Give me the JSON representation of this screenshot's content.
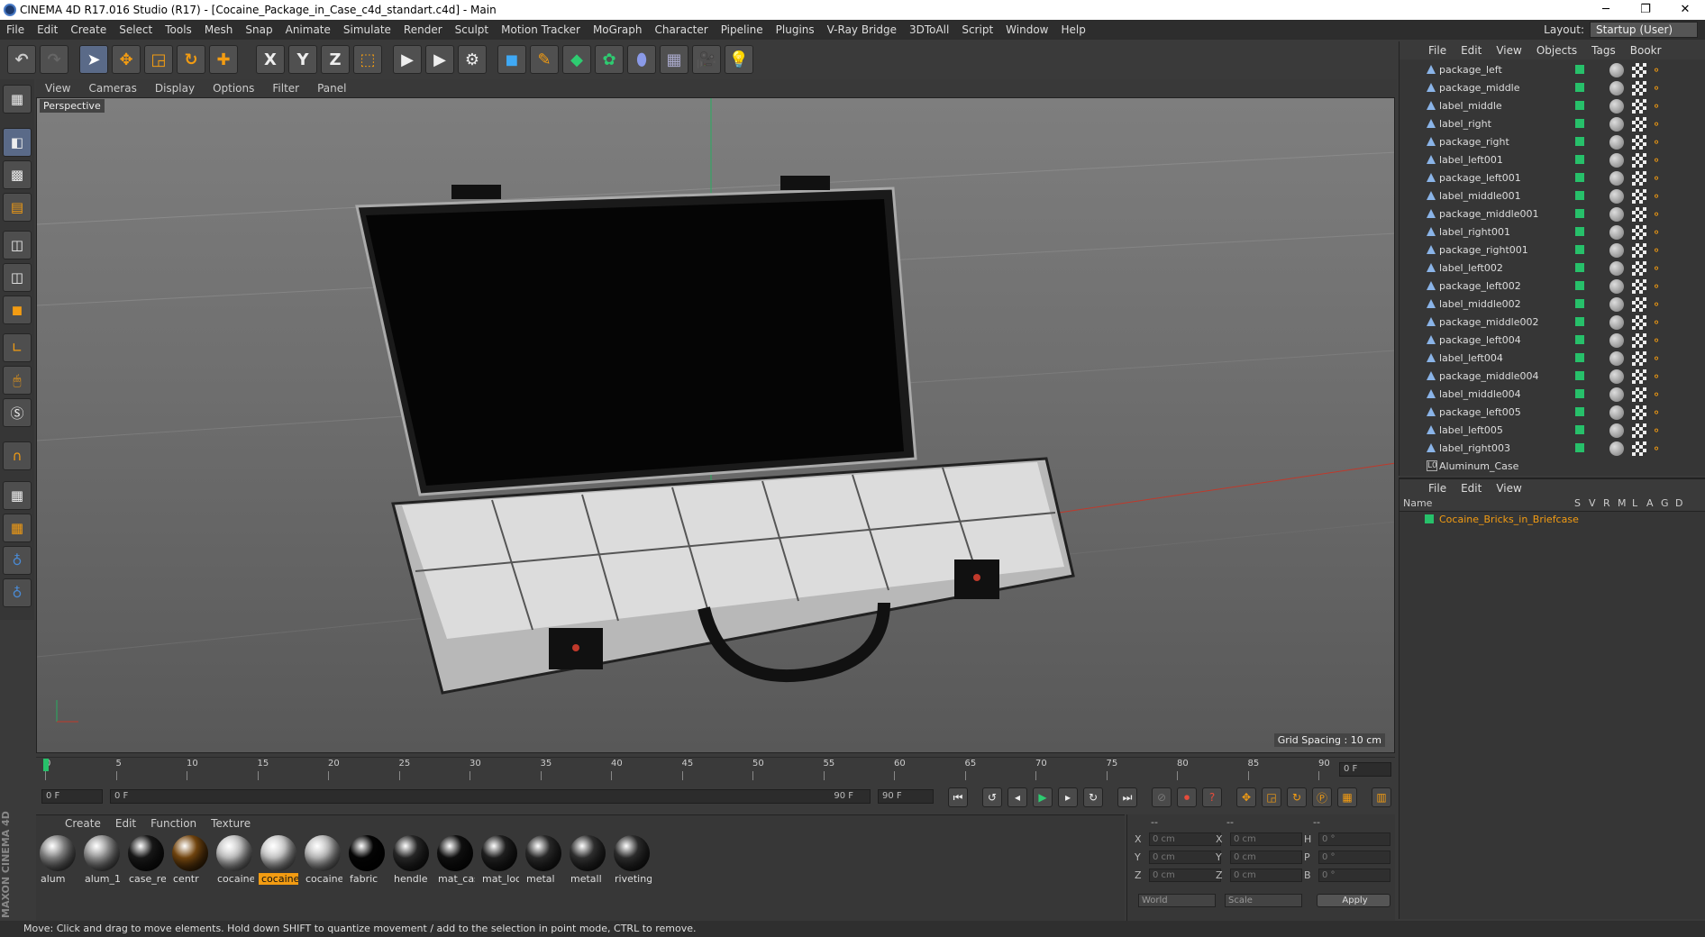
{
  "window": {
    "title": "CINEMA 4D R17.016 Studio (R17) - [Cocaine_Package_in_Case_c4d_standart.c4d] - Main",
    "minimize": "─",
    "maximize": "❐",
    "close": "✕"
  },
  "menubar": [
    "File",
    "Edit",
    "Create",
    "Select",
    "Tools",
    "Mesh",
    "Snap",
    "Animate",
    "Simulate",
    "Render",
    "Sculpt",
    "Motion Tracker",
    "MoGraph",
    "Character",
    "Pipeline",
    "Plugins",
    "V-Ray Bridge",
    "3DToAll",
    "Script",
    "Window",
    "Help"
  ],
  "layout": {
    "label": "Layout:",
    "value": "Startup (User)"
  },
  "toolbar": {
    "x": "X",
    "y": "Y",
    "z": "Z"
  },
  "viewport": {
    "menu": [
      "View",
      "Cameras",
      "Display",
      "Options",
      "Filter",
      "Panel"
    ],
    "label": "Perspective",
    "grid_spacing": "Grid Spacing : 10 cm"
  },
  "timeline": {
    "ticks": [
      "0",
      "5",
      "10",
      "15",
      "20",
      "25",
      "30",
      "35",
      "40",
      "45",
      "50",
      "55",
      "60",
      "65",
      "70",
      "75",
      "80",
      "85",
      "90"
    ],
    "frame_end_field": "0 F",
    "start_field": "0 F",
    "range_field": "0 F",
    "range_end": "90 F",
    "end_field": "90 F"
  },
  "materials": {
    "menu": [
      "Create",
      "Edit",
      "Function",
      "Texture"
    ],
    "items": [
      {
        "name": "alum",
        "color": "#8a8a8a"
      },
      {
        "name": "alum_1",
        "color": "#9a9a9a"
      },
      {
        "name": "case_rev",
        "color": "#1a1a1a"
      },
      {
        "name": "centr",
        "color": "#7a4a10"
      },
      {
        "name": "cocaine",
        "color": "#c8c8c8"
      },
      {
        "name": "cocaine",
        "color": "#d0d0d0"
      },
      {
        "name": "cocaine",
        "color": "#c0c0c0"
      },
      {
        "name": "fabric",
        "color": "#050505"
      },
      {
        "name": "hendle",
        "color": "#2a2a2a"
      },
      {
        "name": "mat_cas",
        "color": "#111111"
      },
      {
        "name": "mat_locl",
        "color": "#222222"
      },
      {
        "name": "metal",
        "color": "#2c2c2c"
      },
      {
        "name": "metall",
        "color": "#333333"
      },
      {
        "name": "riveting",
        "color": "#303030"
      }
    ],
    "selected_index": 5
  },
  "coords": {
    "rows": [
      {
        "a": "X",
        "av": "0 cm",
        "b": "X",
        "bv": "0 cm",
        "c": "H",
        "cv": "0 °"
      },
      {
        "a": "Y",
        "av": "0 cm",
        "b": "Y",
        "bv": "0 cm",
        "c": "P",
        "cv": "0 °"
      },
      {
        "a": "Z",
        "av": "0 cm",
        "b": "Z",
        "bv": "0 cm",
        "c": "B",
        "cv": "0 °"
      }
    ],
    "world": "World",
    "scale": "Scale",
    "apply": "Apply",
    "dashes": "--"
  },
  "object_manager": {
    "menu": [
      "File",
      "Edit",
      "View",
      "Objects",
      "Tags",
      "Bookr"
    ],
    "objects": [
      "package_left",
      "package_middle",
      "label_middle",
      "label_right",
      "package_right",
      "label_left001",
      "package_left001",
      "label_middle001",
      "package_middle001",
      "label_right001",
      "package_right001",
      "label_left002",
      "package_left002",
      "label_middle002",
      "package_middle002",
      "package_left004",
      "label_left004",
      "package_middle004",
      "label_middle004",
      "package_left005",
      "label_left005",
      "label_right003",
      "Aluminum_Case"
    ]
  },
  "attr_manager": {
    "menu": [
      "File",
      "Edit",
      "View"
    ],
    "columns": {
      "name": "Name",
      "s": "S",
      "v": "V",
      "r": "R",
      "m": "M",
      "l": "L",
      "a": "A",
      "g": "G",
      "d": "D"
    },
    "layer": "Cocaine_Bricks_in_Briefcase",
    "layer_color": "#f39c12"
  },
  "status": "Move: Click and drag to move elements. Hold down SHIFT to quantize movement / add to the selection in point mode, CTRL to remove.",
  "maxon": "MAXON CINEMA 4D"
}
